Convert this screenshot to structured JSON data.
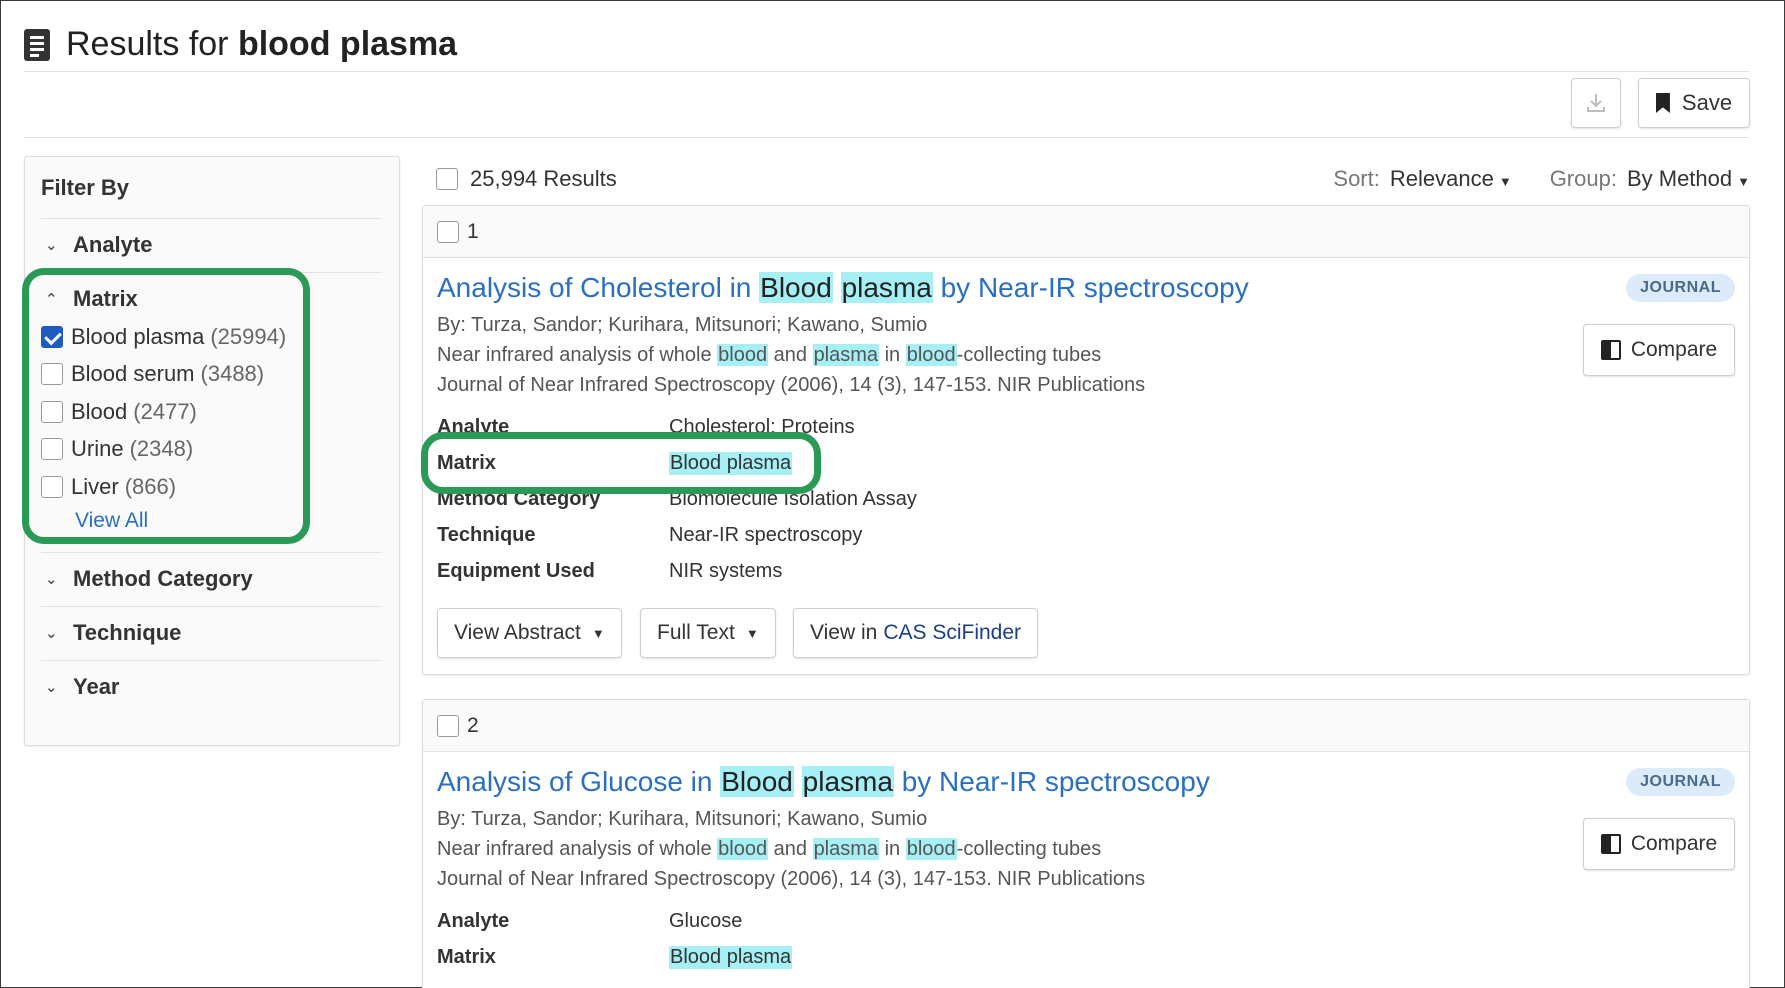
{
  "header": {
    "title_prefix": "Results for",
    "title_query": "blood plasma"
  },
  "toolbar": {
    "save_label": "Save"
  },
  "sidebar": {
    "title": "Filter By",
    "sections": [
      {
        "label": "Analyte",
        "expanded": false
      },
      {
        "label": "Matrix",
        "expanded": true
      },
      {
        "label": "Method Category",
        "expanded": false
      },
      {
        "label": "Technique",
        "expanded": false
      },
      {
        "label": "Year",
        "expanded": false
      }
    ],
    "matrix_options": [
      {
        "label": "Blood plasma",
        "count": "(25994)",
        "checked": true
      },
      {
        "label": "Blood serum",
        "count": "(3488)",
        "checked": false
      },
      {
        "label": "Blood",
        "count": "(2477)",
        "checked": false
      },
      {
        "label": "Urine",
        "count": "(2348)",
        "checked": false
      },
      {
        "label": "Liver",
        "count": "(866)",
        "checked": false
      }
    ],
    "view_all": "View All"
  },
  "results": {
    "count": "25,994 Results",
    "sort_label": "Sort:",
    "sort_value": "Relevance",
    "group_label": "Group:",
    "group_value": "By Method"
  },
  "cards": [
    {
      "index": "1",
      "title_a": "Analysis of Cholesterol in",
      "title_hl1": "Blood",
      "title_hl2": "plasma",
      "title_b": "by Near-IR spectroscopy",
      "badge": "JOURNAL",
      "compare": "Compare",
      "authors": "By: Turza, Sandor; Kurihara, Mitsunori; Kawano, Sumio",
      "source_parts": [
        "Near infrared analysis of whole ",
        "blood",
        " and ",
        "plasma",
        " in ",
        "blood",
        "-collecting tubes"
      ],
      "journal": "Journal of Near Infrared Spectroscopy (2006), 14 (3), 147-153. NIR Publications",
      "fields": [
        {
          "k": "Analyte",
          "v": "Cholesterol; Proteins"
        },
        {
          "k": "Matrix",
          "v": "Blood plasma"
        },
        {
          "k": "Method Category",
          "v": "Biomolecule Isolation Assay"
        },
        {
          "k": "Technique",
          "v": "Near-IR spectroscopy"
        },
        {
          "k": "Equipment Used",
          "v": "NIR systems"
        }
      ],
      "actions": {
        "abstract": "View Abstract",
        "fulltext": "Full Text",
        "view_in": "View in",
        "scifinder": "CAS SciFinder"
      }
    },
    {
      "index": "2",
      "title_a": "Analysis of Glucose in",
      "title_hl1": "Blood",
      "title_hl2": "plasma",
      "title_b": "by Near-IR spectroscopy",
      "badge": "JOURNAL",
      "compare": "Compare",
      "authors": "By: Turza, Sandor; Kurihara, Mitsunori; Kawano, Sumio",
      "source_parts": [
        "Near infrared analysis of whole ",
        "blood",
        " and ",
        "plasma",
        " in ",
        "blood",
        "-collecting tubes"
      ],
      "journal": "Journal of Near Infrared Spectroscopy (2006), 14 (3), 147-153. NIR Publications",
      "fields": [
        {
          "k": "Analyte",
          "v": "Glucose"
        },
        {
          "k": "Matrix",
          "v": "Blood plasma"
        }
      ]
    }
  ],
  "icons": [
    "document-icon",
    "download-icon",
    "bookmark-icon",
    "chevron-down-icon",
    "chevron-up-icon",
    "checkbox-icon",
    "compare-icon",
    "caret-down-icon"
  ],
  "colors": {
    "link": "#2a6fc2",
    "highlight": "#a6f0f5",
    "annotation": "#2b9a57",
    "checkbox_checked": "#1d5bbf",
    "badge_bg": "#dcebf9"
  }
}
